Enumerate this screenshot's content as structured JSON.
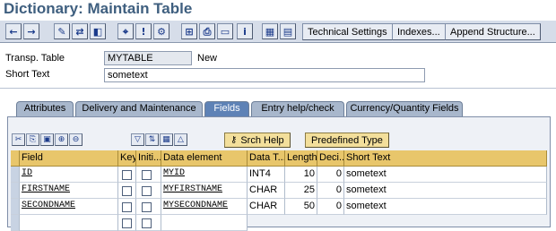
{
  "window": {
    "title": "Dictionary: Maintain Table"
  },
  "toolbar": {
    "icons": [
      "back-icon",
      "forward-icon",
      "edit-icon",
      "display-change-icon",
      "other-object-icon",
      "where-used-icon",
      "check-icon",
      "activate-icon",
      "hierarchy-icon",
      "print-icon",
      "note-icon",
      "info-icon",
      "layout-icon",
      "display-icon",
      "details-icon"
    ],
    "technical_settings": "Technical Settings",
    "indexes": "Indexes...",
    "append_structure": "Append Structure..."
  },
  "header": {
    "transp_table_label": "Transp. Table",
    "table_name": "MYTABLE",
    "status": "New",
    "short_text_label": "Short Text",
    "short_text": "sometext"
  },
  "tabs": [
    {
      "label": "Attributes",
      "active": false
    },
    {
      "label": "Delivery and Maintenance",
      "active": false
    },
    {
      "label": "Fields",
      "active": true
    },
    {
      "label": "Entry help/check",
      "active": false
    },
    {
      "label": "Currency/Quantity Fields",
      "active": false
    }
  ],
  "panel_toolbar": {
    "icons": [
      "cut-icon",
      "copy-icon",
      "paste-icon",
      "insert-row-icon",
      "delete-row-icon",
      "filter-icon",
      "sort-icon",
      "table-settings-icon",
      "scroll-up-icon"
    ],
    "srch_help": "Srch Help",
    "predefined_type": "Predefined Type"
  },
  "grid": {
    "columns": [
      "Field",
      "Key",
      "Initi...",
      "Data element",
      "Data T...",
      "Length",
      "Deci...",
      "Short Text"
    ],
    "rows": [
      {
        "field": "ID",
        "key": false,
        "initial": false,
        "data_element": "MYID",
        "data_type": "INT4",
        "length": "10",
        "decimals": "0",
        "short_text": "sometext"
      },
      {
        "field": "FIRSTNAME",
        "key": false,
        "initial": false,
        "data_element": "MYFIRSTNAME",
        "data_type": "CHAR",
        "length": "25",
        "decimals": "0",
        "short_text": "sometext"
      },
      {
        "field": "SECONDNAME",
        "key": false,
        "initial": false,
        "data_element": "MYSECONDNAME",
        "data_type": "CHAR",
        "length": "50",
        "decimals": "0",
        "short_text": "sometext"
      },
      {
        "field": "",
        "key": false,
        "initial": false,
        "data_element": "",
        "data_type": "",
        "length": "",
        "decimals": "",
        "short_text": ""
      }
    ]
  },
  "colors": {
    "title": "#3f5f7f",
    "toolbar_bg": "#d6dde9",
    "active_tab": "#5e82b6",
    "header_cell": "#e8c66b"
  }
}
